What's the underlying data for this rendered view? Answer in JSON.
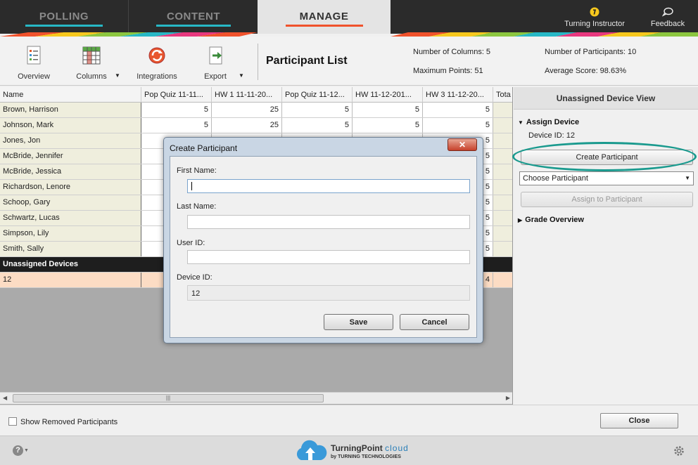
{
  "nav": {
    "tabs": [
      {
        "label": "POLLING",
        "accent": "#27b8c6"
      },
      {
        "label": "CONTENT",
        "accent": "#27b8c6"
      },
      {
        "label": "MANAGE",
        "accent": "#f0522c"
      }
    ],
    "active_tab": "MANAGE",
    "instructor_label": "Turning Instructor",
    "feedback_label": "Feedback"
  },
  "toolbar": {
    "overview_label": "Overview",
    "columns_label": "Columns",
    "integrations_label": "Integrations",
    "export_label": "Export",
    "title": "Participant List"
  },
  "stats": {
    "num_columns": "Number of Columns: 5",
    "max_points": "Maximum Points: 51",
    "num_participants": "Number of Participants: 10",
    "avg_score": "Average Score: 98.63%"
  },
  "grid": {
    "headers": [
      "Name",
      "Pop Quiz 11-11...",
      "HW 1 11-11-20...",
      "Pop Quiz 11-12...",
      "HW 11-12-201...",
      "HW 3 11-12-20...",
      "Tota"
    ],
    "rows": [
      {
        "name": "Brown, Harrison",
        "values": [
          "5",
          "25",
          "5",
          "5",
          "5"
        ]
      },
      {
        "name": "Johnson, Mark",
        "values": [
          "5",
          "25",
          "5",
          "5",
          "5"
        ]
      },
      {
        "name": "Jones, Jon",
        "values": [
          "",
          "",
          "",
          "",
          "5"
        ]
      },
      {
        "name": "McBride, Jennifer",
        "values": [
          "",
          "",
          "",
          "",
          "5"
        ]
      },
      {
        "name": "McBride, Jessica",
        "values": [
          "",
          "",
          "",
          "",
          "5"
        ]
      },
      {
        "name": "Richardson, Lenore",
        "values": [
          "",
          "",
          "",
          "",
          "5"
        ]
      },
      {
        "name": "Schoop, Gary",
        "values": [
          "",
          "",
          "",
          "",
          "5"
        ]
      },
      {
        "name": "Schwartz, Lucas",
        "values": [
          "",
          "",
          "",
          "",
          "5"
        ]
      },
      {
        "name": "Simpson, Lily",
        "values": [
          "",
          "",
          "",
          "",
          "5"
        ]
      },
      {
        "name": "Smith, Sally",
        "values": [
          "",
          "",
          "",
          "",
          "5"
        ]
      }
    ],
    "unassigned_label": "Unassigned Devices",
    "unassigned_row": {
      "name": "12",
      "values": [
        "",
        "",
        "",
        "",
        "4"
      ]
    }
  },
  "right_panel": {
    "title": "Unassigned Device View",
    "assign_heading": "Assign Device",
    "device_id": "Device ID: 12",
    "create_button": "Create Participant",
    "choose_select": "Choose Participant",
    "assign_button": "Assign to Participant",
    "grade_heading": "Grade Overview",
    "highlight_color": "#1a9a8e"
  },
  "bottom": {
    "show_removed": "Show Removed Participants",
    "close_button": "Close"
  },
  "footer": {
    "logo_brand": "TurningPoint",
    "logo_cloud": "cloud",
    "logo_by": "by TURNING TECHNOLOGIES"
  },
  "dialog": {
    "title": "Create Participant",
    "close_glyph": "✕",
    "first_name_label": "First Name:",
    "first_name_value": "",
    "last_name_label": "Last Name:",
    "last_name_value": "",
    "user_id_label": "User ID:",
    "user_id_value": "",
    "device_id_label": "Device ID:",
    "device_id_value": "12",
    "save_button": "Save",
    "cancel_button": "Cancel"
  }
}
